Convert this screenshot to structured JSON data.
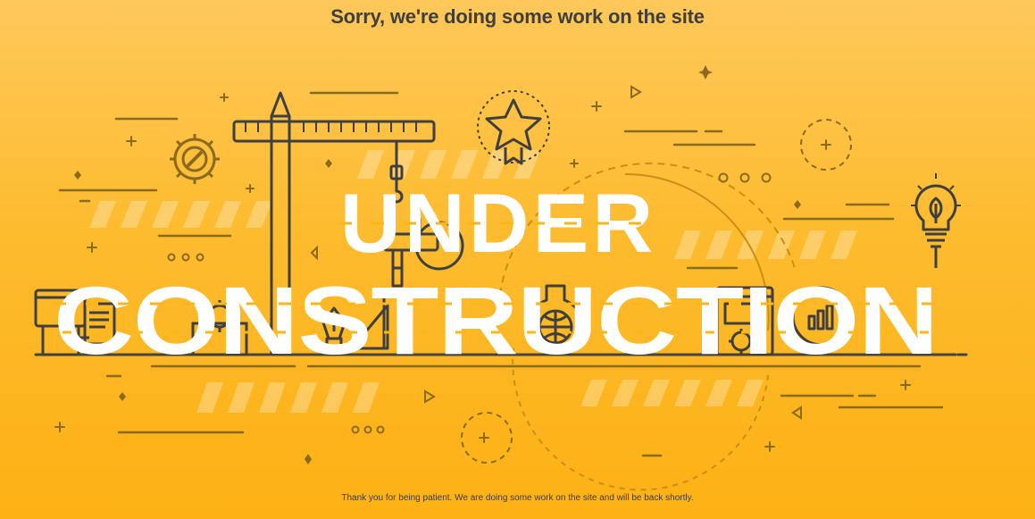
{
  "header": {
    "message": "Sorry, we're doing some work on the site"
  },
  "illustration": {
    "word_top": "UNDER",
    "word_bottom": "CONSTRUCTION"
  },
  "footer": {
    "message": "Thank you for being patient. We are doing some work on the site and will be back shortly."
  },
  "colors": {
    "background_top": "#fec85a",
    "background_bottom": "#fdb114",
    "line_art": "#3f3f3f",
    "lettering": "#ffffff"
  }
}
